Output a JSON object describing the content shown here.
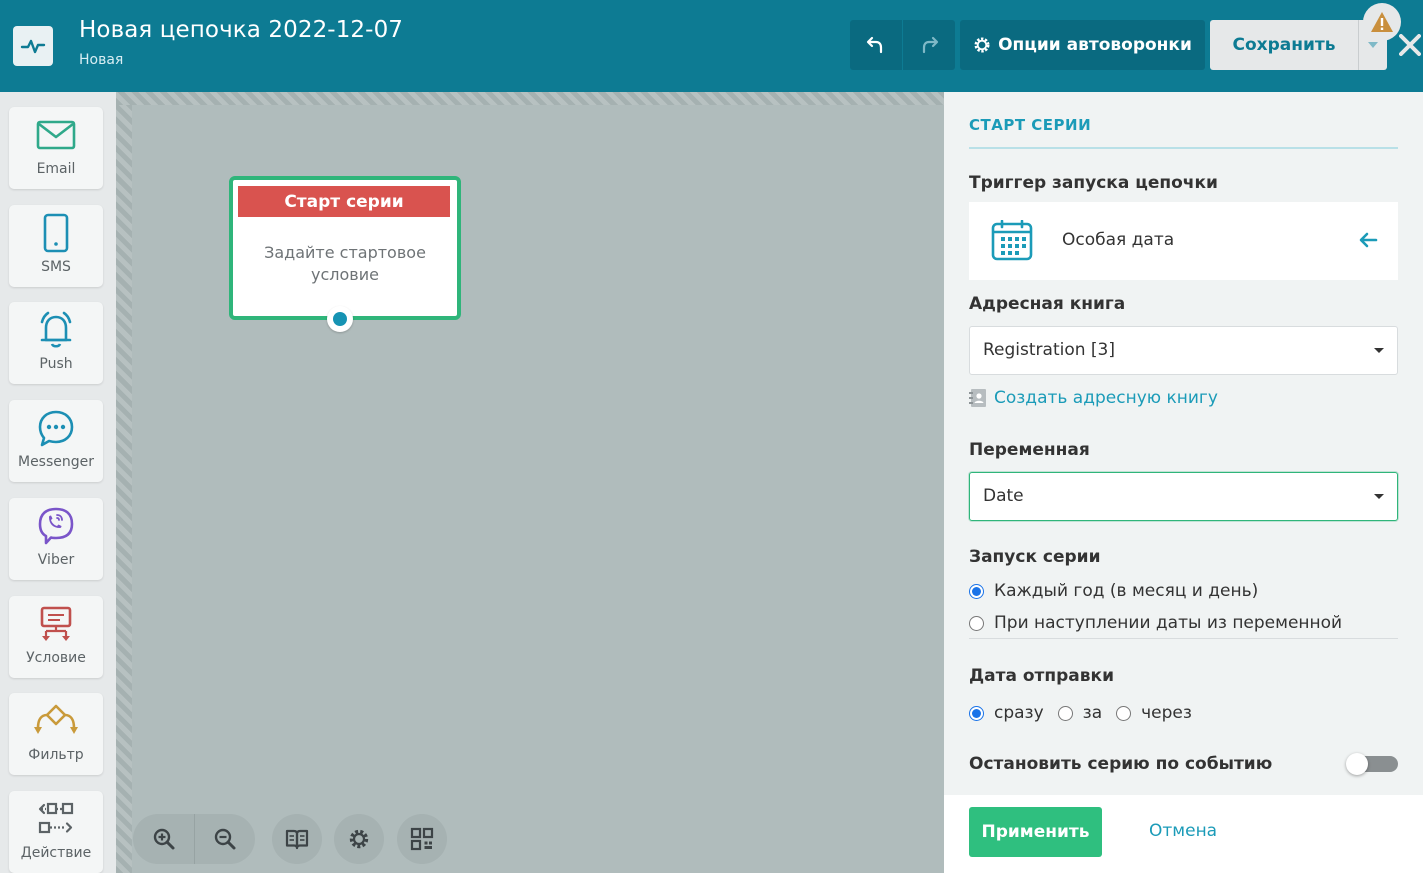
{
  "header": {
    "title": "Новая цепочка 2022-12-07",
    "status": "Новая",
    "options_label": "Опции автоворонки",
    "save_label": "Сохранить"
  },
  "palette": {
    "items": [
      {
        "label": "Email",
        "icon": "envelope-icon"
      },
      {
        "label": "SMS",
        "icon": "phone-icon"
      },
      {
        "label": "Push",
        "icon": "bell-icon"
      },
      {
        "label": "Messenger",
        "icon": "chat-bubble-icon"
      },
      {
        "label": "Viber",
        "icon": "viber-icon"
      },
      {
        "label": "Условие",
        "icon": "condition-icon"
      },
      {
        "label": "Фильтр",
        "icon": "filter-icon"
      },
      {
        "label": "Действие",
        "icon": "action-icon"
      }
    ]
  },
  "canvas": {
    "node": {
      "title": "Старт серии",
      "body": "Задайте стартовое условие"
    }
  },
  "panel": {
    "title": "СТАРТ СЕРИИ",
    "trigger_label": "Триггер запуска цепочки",
    "trigger_value": "Особая дата",
    "address_book_label": "Адресная книга",
    "address_book_value": "Registration [3]",
    "create_book_link": "Создать адресную книгу",
    "variable_label": "Переменная",
    "variable_value": "Date",
    "launch_label": "Запуск серии",
    "launch_options": [
      {
        "label": "Каждый год (в месяц и день)",
        "checked": true
      },
      {
        "label": "При наступлении даты из переменной",
        "checked": false
      }
    ],
    "send_date_label": "Дата отправки",
    "send_date_options": [
      {
        "label": "сразу",
        "checked": true
      },
      {
        "label": "за",
        "checked": false
      },
      {
        "label": "через",
        "checked": false
      }
    ],
    "stop_label": "Остановить серию по событию",
    "stop_enabled": false,
    "apply_label": "Применить",
    "cancel_label": "Отмена"
  },
  "colors": {
    "header_bg": "#0d7b93",
    "accent": "#1b9bb8",
    "node_border": "#2fb57a",
    "node_header": "#d9534f",
    "apply_bg": "#2fbf7f"
  }
}
